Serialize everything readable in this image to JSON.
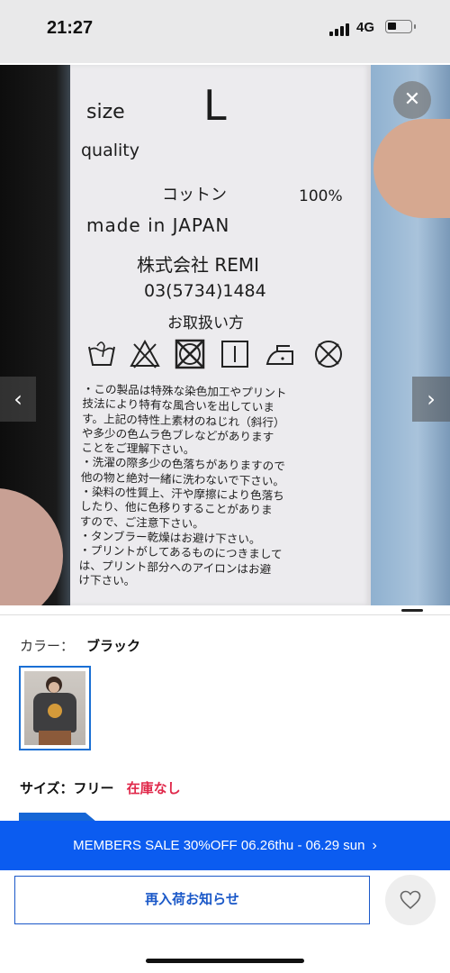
{
  "status_bar": {
    "time": "21:27",
    "network": "4G",
    "battery_level": 0.3
  },
  "photo": {
    "label_text": {
      "size_key": "size",
      "size_value": "L",
      "quality_key": "quality",
      "fiber": "コットン",
      "percent": "100%",
      "made_in": "made in JAPAN",
      "company": "株式会社 REMI",
      "phone": "03(5734)1484",
      "care_heading": "お取扱い方",
      "notes": [
        "・この製品は特殊な染色加工やプリント",
        "技法により特有な風合いを出していま",
        "す。上記の特性上素材のねじれ（斜行）",
        "や多少の色ムラ色ブレなどがあります",
        "ことをご理解下さい。",
        "・洗濯の際多少の色落ちがありますので",
        "他の物と絶対一緒に洗わないで下さい。",
        "・染料の性質上、汗や摩擦により色落ち",
        "したり、他に色移りすることがありま",
        "すので、ご注意下さい。",
        "・タンブラー乾燥はお避け下さい。",
        "・プリントがしてあるものにつきまして",
        "は、プリント部分へのアイロンはお避",
        "け下さい。"
      ]
    },
    "close_icon": "close-icon",
    "prev_icon": "chevron-left-icon",
    "next_icon": "chevron-right-icon"
  },
  "product": {
    "color_label": "カラー：",
    "color_value": "ブラック",
    "size_label": "サイズ：フリー",
    "stock_status": "在庫なし"
  },
  "banner": {
    "text": "MEMBERS SALE 30%OFF 06.26thu - 06.29 sun",
    "chevron": "›"
  },
  "actions": {
    "restock_label": "再入荷お知らせ",
    "favorite_icon": "heart-icon"
  },
  "colors": {
    "accent_blue": "#0b5cf0",
    "stock_red": "#e0284a",
    "button_blue": "#1a58c8"
  }
}
